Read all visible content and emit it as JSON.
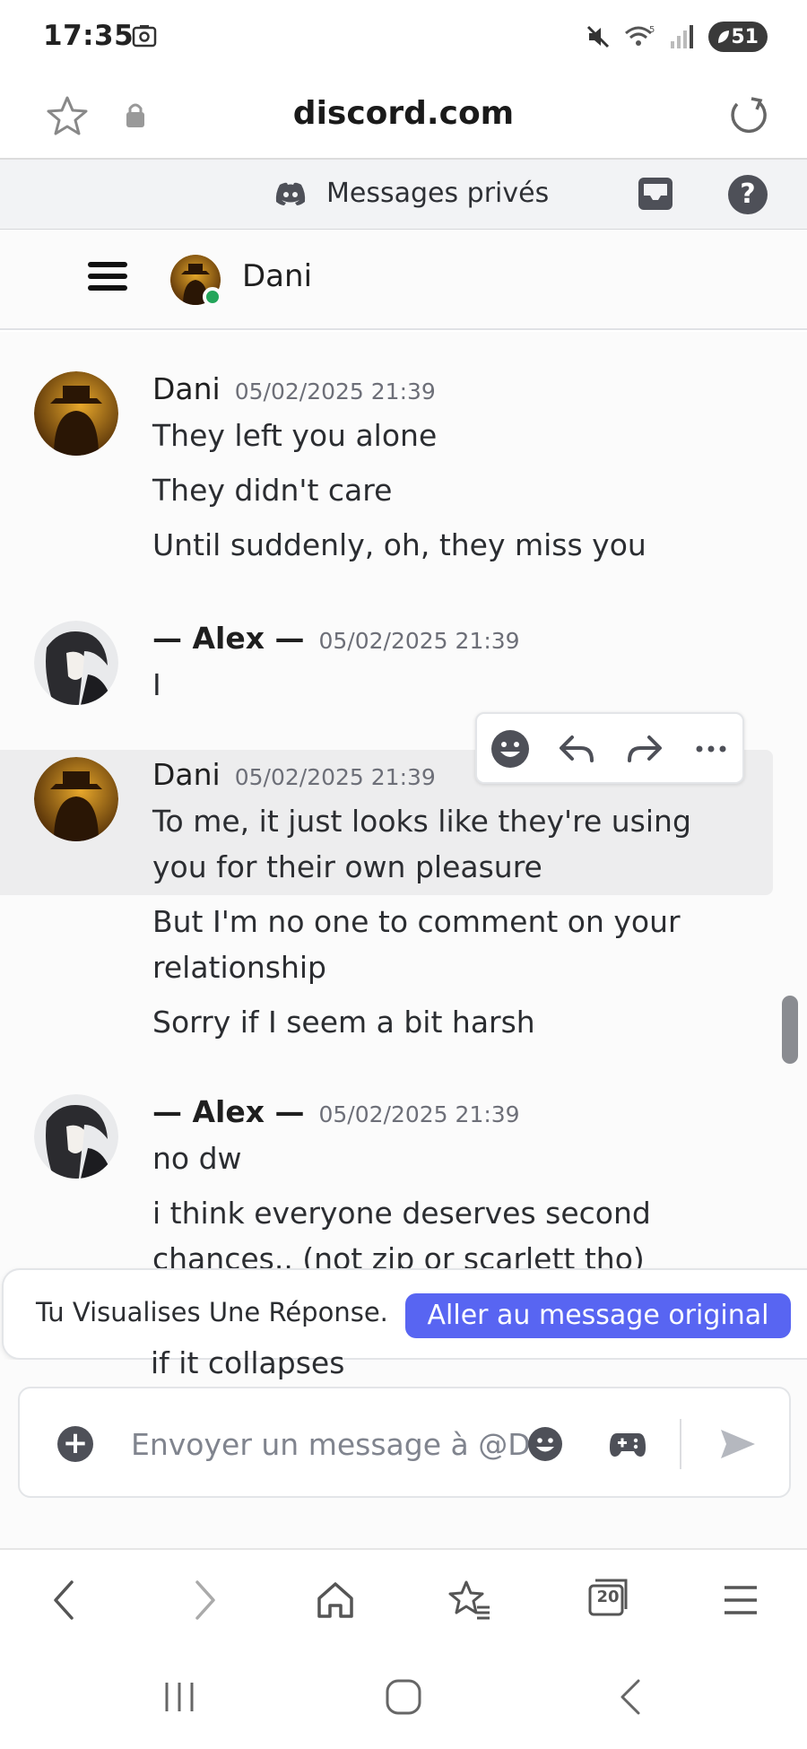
{
  "status_bar": {
    "time": "17:35",
    "battery": "51"
  },
  "browser": {
    "url": "discord.com"
  },
  "discord_header": {
    "title": "Messages privés"
  },
  "channel": {
    "name": "Dani"
  },
  "messages": [
    {
      "author": "Dani",
      "timestamp": "05/02/2025 21:39",
      "lines": [
        "They left you alone",
        "They didn't care",
        "Until suddenly, oh, they miss you"
      ]
    },
    {
      "author": "— Alex —",
      "timestamp": "05/02/2025 21:39",
      "lines": [
        "I"
      ]
    },
    {
      "author": "Dani",
      "timestamp": "05/02/2025 21:39",
      "lines": [
        "To me, it just looks like they're using",
        "you for their own pleasure",
        "But I'm no one to comment on your",
        "relationship",
        "Sorry if I seem a bit harsh"
      ]
    },
    {
      "author": "— Alex —",
      "timestamp": "05/02/2025 21:39",
      "lines": [
        "no dw",
        "i think everyone deserves second",
        "chances.. (not zip or scarlett tho)"
      ]
    }
  ],
  "hidden_line": "if it collapses",
  "reply_banner": {
    "text": "Tu Visualises Une Réponse.",
    "button": "Aller au message original"
  },
  "composer": {
    "placeholder": "Envoyer un message à @Dani"
  },
  "browser_nav": {
    "tab_count": "20"
  },
  "colors": {
    "accent": "#5865f2",
    "online": "#23a55a"
  }
}
